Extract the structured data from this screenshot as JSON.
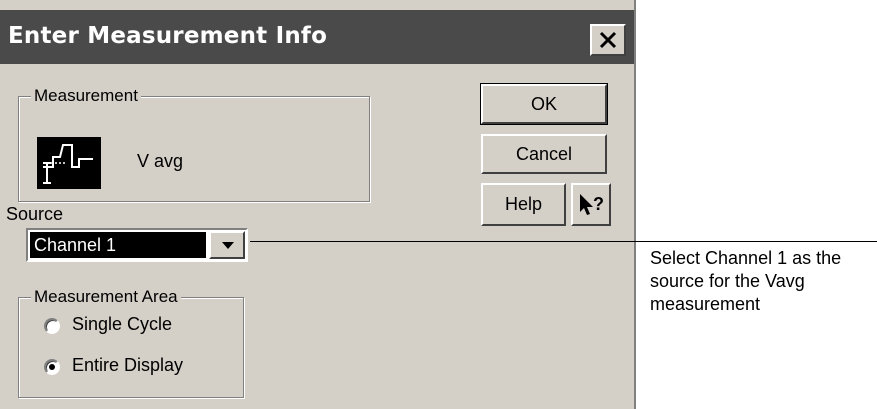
{
  "dialog": {
    "title": "Enter Measurement Info",
    "close_icon": "close-icon"
  },
  "measurement_group": {
    "label": "Measurement",
    "icon": "vavg-waveform-icon",
    "name": "V avg"
  },
  "buttons": {
    "ok": "OK",
    "cancel": "Cancel",
    "help": "Help",
    "whats_this_icon": "whats-this-icon"
  },
  "source": {
    "label": "Source",
    "selected": "Channel 1",
    "dropdown_icon": "chevron-down-icon"
  },
  "measurement_area": {
    "label": "Measurement Area",
    "options": [
      {
        "label": "Single Cycle",
        "checked": false
      },
      {
        "label": "Entire Display",
        "checked": true
      }
    ]
  },
  "callout": {
    "lines": [
      "Select Channel 1 as the",
      "source for the Vavg",
      "measurement"
    ]
  },
  "colors": {
    "titlebar": "#4a4a4a",
    "dialog_face": "#d4d0c8",
    "selection": "#000000"
  }
}
